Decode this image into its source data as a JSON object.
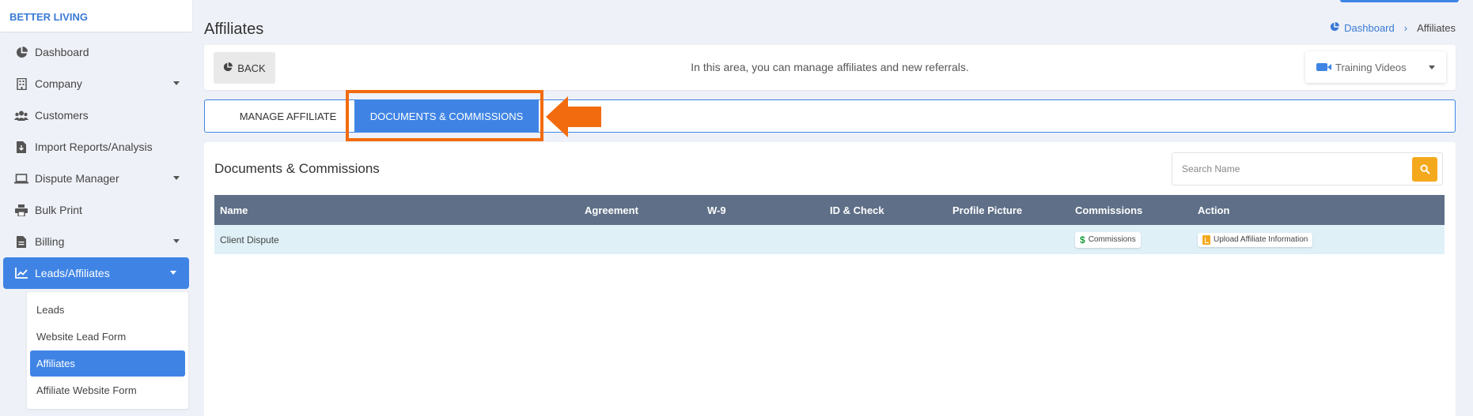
{
  "brand": "BETTER LIVING",
  "sidebar": {
    "items": [
      {
        "label": "Dashboard",
        "icon": "pie-chart-icon"
      },
      {
        "label": "Company",
        "icon": "building-icon"
      },
      {
        "label": "Customers",
        "icon": "users-icon"
      },
      {
        "label": "Import Reports/Analysis",
        "icon": "file-import-icon"
      },
      {
        "label": "Dispute Manager",
        "icon": "laptop-icon"
      },
      {
        "label": "Bulk Print",
        "icon": "printer-icon"
      },
      {
        "label": "Billing",
        "icon": "wallet-icon"
      },
      {
        "label": "Leads/Affiliates",
        "icon": "chart-line-icon"
      }
    ],
    "submenu": [
      {
        "label": "Leads"
      },
      {
        "label": "Website Lead Form"
      },
      {
        "label": "Affiliates"
      },
      {
        "label": "Affiliate Website Form"
      }
    ]
  },
  "page": {
    "title": "Affiliates",
    "breadcrumb": {
      "home": "Dashboard",
      "current": "Affiliates"
    }
  },
  "topcard": {
    "back_label": "BACK",
    "info": "In this area, you can manage affiliates and new referrals.",
    "training_label": "Training Videos"
  },
  "tabs": {
    "manage": "MANAGE AFFILIATE",
    "docs": "DOCUMENTS & COMMISSIONS"
  },
  "main": {
    "section_title": "Documents & Commissions",
    "search_placeholder": "Search Name",
    "columns": [
      "Name",
      "Agreement",
      "W-9",
      "ID & Check",
      "Profile Picture",
      "Commissions",
      "Action"
    ],
    "rows": [
      {
        "name": "Client Dispute",
        "commissions_label": "Commissions",
        "action_label": "Upload Affiliate Information"
      }
    ]
  },
  "colors": {
    "accent": "#3f84e5",
    "highlight": "#f26b0f",
    "search_button": "#f4a91c",
    "table_header": "#5e6f87",
    "row_bg": "#dff0f7"
  }
}
